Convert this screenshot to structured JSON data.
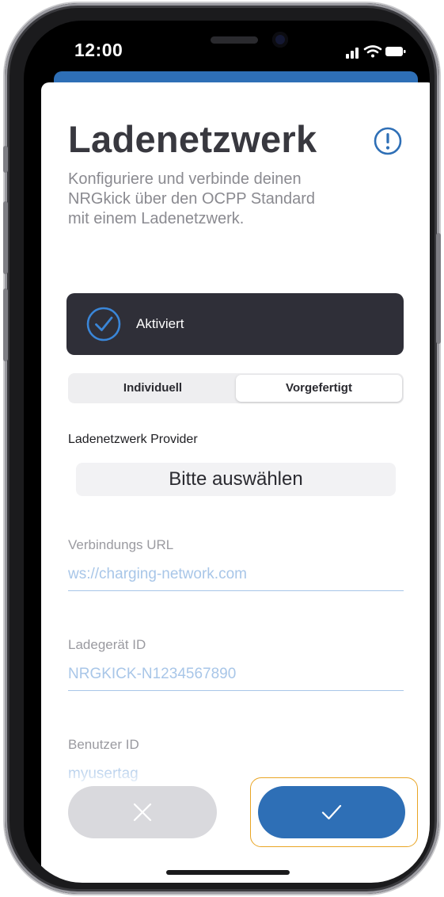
{
  "status_bar": {
    "time": "12:00",
    "icons": [
      "signal-icon",
      "wifi-icon",
      "battery-icon"
    ]
  },
  "header": {
    "title": "Ladenetzwerk",
    "description": "Konfiguriere und verbinde deinen NRGkick über den OCPP Standard mit einem Ladenetzwerk.",
    "info_icon": "info-circle-icon"
  },
  "activation": {
    "label": "Aktiviert",
    "checked": true
  },
  "mode_selector": {
    "options": [
      "Individuell",
      "Vorgefertigt"
    ],
    "selected": "Vorgefertigt"
  },
  "provider": {
    "label": "Ladenetzwerk Provider",
    "value": "Bitte auswählen"
  },
  "fields": {
    "url_label": "Verbindungs URL",
    "url_value": "ws://charging-network.com",
    "charger_label": "Ladegerät ID",
    "charger_value": "NRGKICK-N1234567890",
    "user_label": "Benutzer ID",
    "user_value": "myusertag"
  },
  "actions": {
    "cancel_icon": "close-icon",
    "confirm_icon": "checkmark-icon"
  },
  "colors": {
    "accent": "#2e6fb6",
    "dark_card": "#2f2f38",
    "input_text": "#a8c6e8",
    "highlight": "#e9a524"
  }
}
